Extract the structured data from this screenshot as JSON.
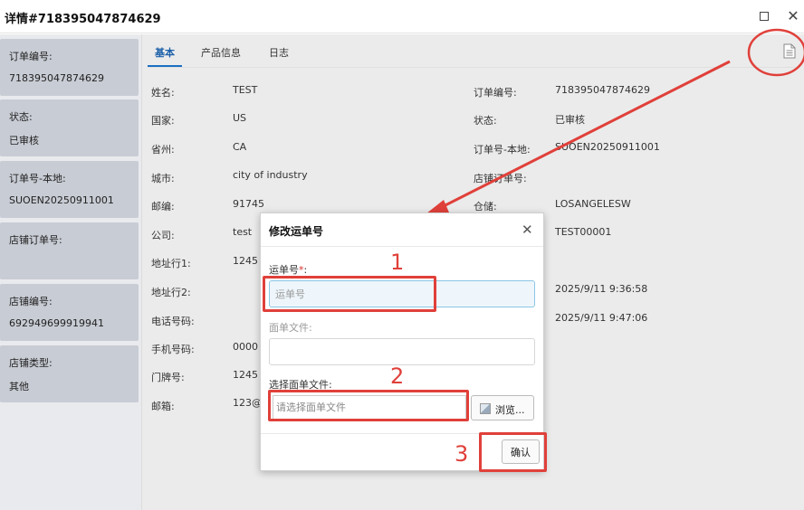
{
  "window": {
    "title": "详情#718395047874629",
    "maximize_icon": "maximize-icon",
    "close_icon": "close-icon"
  },
  "sidebar": {
    "cards": [
      {
        "label": "订单编号:",
        "value": "718395047874629"
      },
      {
        "label": "状态:",
        "value": "已审核"
      },
      {
        "label": "订单号-本地:",
        "value": "SUOEN20250911001"
      },
      {
        "label": "店铺订单号:",
        "value": ""
      },
      {
        "label": "店铺编号:",
        "value": "692949699919941"
      },
      {
        "label": "店铺类型:",
        "value": "其他"
      }
    ]
  },
  "tabs": [
    {
      "label": "基本",
      "active": true
    },
    {
      "label": "产品信息",
      "active": false
    },
    {
      "label": "日志",
      "active": false
    }
  ],
  "details": {
    "left": [
      {
        "label": "姓名:",
        "value": "TEST"
      },
      {
        "label": "国家:",
        "value": "US"
      },
      {
        "label": "省州:",
        "value": "CA"
      },
      {
        "label": "城市:",
        "value": "city of industry"
      },
      {
        "label": "邮编:",
        "value": "91745"
      },
      {
        "label": "公司:",
        "value": "test"
      },
      {
        "label": "地址行1:",
        "value": "1245"
      },
      {
        "label": "地址行2:",
        "value": ""
      },
      {
        "label": "电话号码:",
        "value": ""
      },
      {
        "label": "手机号码:",
        "value": "0000"
      },
      {
        "label": "门牌号:",
        "value": "1245"
      },
      {
        "label": "邮箱:",
        "value": "123@"
      }
    ],
    "right": [
      {
        "label": "订单编号:",
        "value": "718395047874629"
      },
      {
        "label": "状态:",
        "value": "已审核"
      },
      {
        "label": "订单号-本地:",
        "value": "SUOEN20250911001"
      },
      {
        "label": "店铺订单号:",
        "value": ""
      },
      {
        "label": "仓储:",
        "value": "LOSANGELESW"
      },
      {
        "label": "",
        "value": "TEST00001"
      },
      {
        "label": "",
        "value": "2025/9/11 9:36:58"
      },
      {
        "label": "",
        "value": "2025/9/11 9:47:06"
      }
    ]
  },
  "dialog": {
    "title": "修改运单号",
    "tracking_label": "运单号",
    "required_mark": "*",
    "tracking_label_suffix": ":",
    "tracking_placeholder": "运单号",
    "label_file_label": "面单文件:",
    "label_file_value": "",
    "choose_file_label": "选择面单文件:",
    "choose_file_placeholder": "请选择面单文件",
    "browse_label": "浏览...",
    "confirm_label": "确认"
  },
  "annotations": {
    "markers": [
      "1",
      "2",
      "3"
    ],
    "color": "#e0403a"
  },
  "colors": {
    "accent": "#1a6fc4",
    "sidebar_card": "#c8ccd4"
  }
}
